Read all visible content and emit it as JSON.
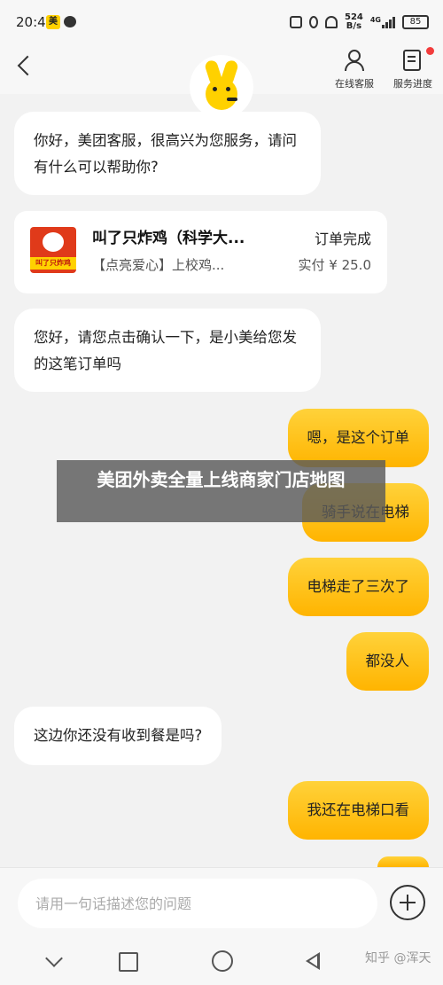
{
  "status_bar": {
    "time": "20:44",
    "app_badge": "美",
    "net_speed_value": "524",
    "net_speed_unit": "B/s",
    "network": "4G",
    "battery": "85"
  },
  "header": {
    "customer_service_label": "在线客服",
    "service_progress_label": "服务进度"
  },
  "messages": [
    {
      "side": "in",
      "text": "你好，美团客服，很高兴为您服务，请问有什么可以帮助你?"
    },
    {
      "side": "in",
      "text": "您好，请您点击确认一下，是小美给您发的这笔订单吗"
    },
    {
      "side": "out",
      "text": "嗯，是这个订单"
    },
    {
      "side": "out",
      "text": "骑手说在电梯"
    },
    {
      "side": "out",
      "text": "电梯走了三次了"
    },
    {
      "side": "out",
      "text": "都没人"
    },
    {
      "side": "in",
      "text": "这边你还没有收到餐是吗?"
    },
    {
      "side": "out",
      "text": "我还在电梯口看"
    }
  ],
  "order_card": {
    "shop_name": "叫了只炸鸡（科学大...",
    "status": "订单完成",
    "description": "【点亮爱心】上校鸡...",
    "amount": "实付 ¥ 25.0",
    "thumb_text": "叫了只炸鸡"
  },
  "banner": {
    "text": "美团外卖全量上线商家门店地图"
  },
  "input": {
    "placeholder": "请用一句话描述您的问题"
  },
  "watermark": "知乎 @浑天",
  "colors": {
    "accent": "#ffd100",
    "bubble_out_top": "#ffd23a",
    "bubble_out_bottom": "#ffb400",
    "background": "#f2f2f2"
  }
}
